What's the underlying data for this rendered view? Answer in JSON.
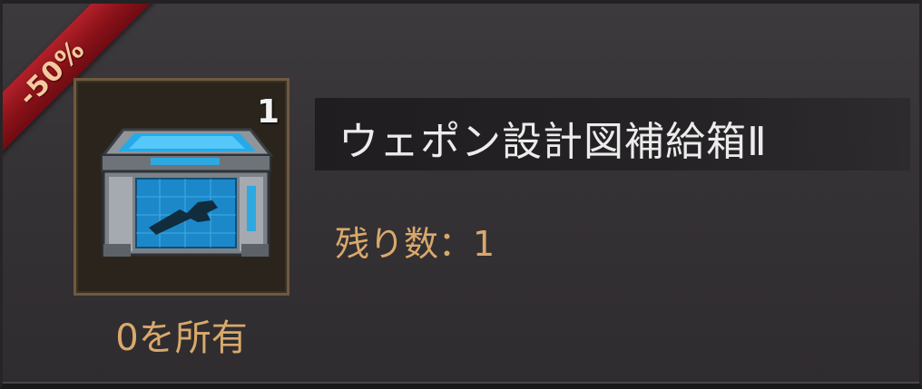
{
  "discount_badge": {
    "text": "-50%",
    "color": "#a51a22"
  },
  "item": {
    "icon": "weapon-blueprint-crate-icon",
    "stack_count": "1",
    "owned_label": "0を所有",
    "title": "ウェポン設計図補給箱Ⅱ",
    "remaining_label": "残り数：1"
  },
  "colors": {
    "accent_text": "#d9a96b",
    "title_text": "#ececec",
    "frame_border": "#6f5a3f"
  }
}
